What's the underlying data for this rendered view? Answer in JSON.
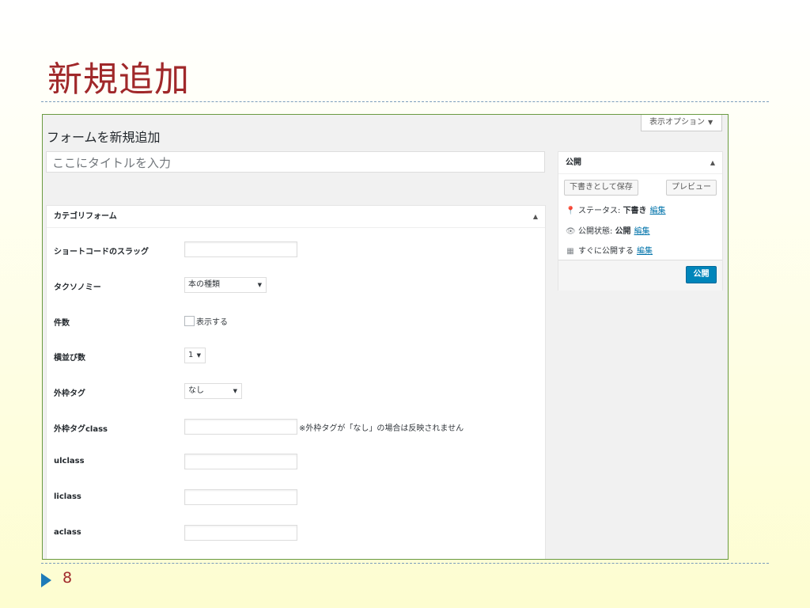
{
  "slide": {
    "title": "新規追加",
    "page_number": "8"
  },
  "screen_options": {
    "label": "表示オプション",
    "arrow": "▼"
  },
  "page_heading": "フォームを新規追加",
  "title_input": {
    "placeholder": "ここにタイトルを入力"
  },
  "category_box": {
    "title": "カテゴリフォーム",
    "toggle": "▲",
    "fields": {
      "shortcode_slug": {
        "label": "ショートコードのスラッグ",
        "value": ""
      },
      "taxonomy": {
        "label": "タクソノミー",
        "selected": "本の種類"
      },
      "count": {
        "label": "件数",
        "checkbox_label": "表示する",
        "checked": false
      },
      "columns": {
        "label": "横並び数",
        "selected": "1"
      },
      "wrapper_tag": {
        "label": "外枠タグ",
        "selected": "なし"
      },
      "wrapper_class": {
        "label": "外枠タグclass",
        "value": "",
        "note": "※外枠タグが「なし」の場合は反映されません"
      },
      "ulclass": {
        "label": "ulclass",
        "value": ""
      },
      "liclass": {
        "label": "liclass",
        "value": ""
      },
      "aclass": {
        "label": "aclass",
        "value": ""
      }
    }
  },
  "publish_box": {
    "title": "公開",
    "toggle": "▲",
    "save_draft_label": "下書きとして保存",
    "preview_label": "プレビュー",
    "status": {
      "label": "ステータス:",
      "value": "下書き",
      "edit": "編集"
    },
    "visibility": {
      "label": "公開状態:",
      "value": "公開",
      "edit": "編集"
    },
    "schedule": {
      "label": "すぐに公開する",
      "edit": "編集"
    },
    "publish_label": "公開"
  },
  "colors": {
    "slide_title": "#a0282a",
    "primary_button": "#0085ba",
    "link": "#0073aa",
    "frame_border": "#6a9a42"
  }
}
